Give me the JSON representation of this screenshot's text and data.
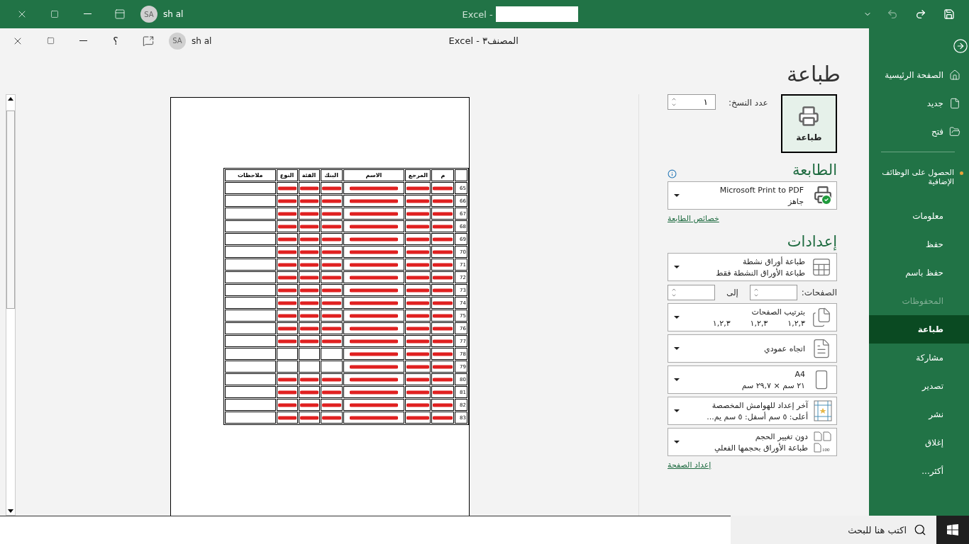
{
  "title_bar": {
    "app": "Excel -",
    "user_initials": "SA",
    "user_name": "sh al"
  },
  "inner_title_bar": {
    "title": "Excel - المصنف٣",
    "help": "؟",
    "user_initials": "SA",
    "user_name": "sh al"
  },
  "sidebar": {
    "top_items": [
      {
        "label": "الصفحة الرئيسية",
        "kind": "home"
      },
      {
        "label": "جديد",
        "kind": "new"
      },
      {
        "label": "فتح",
        "kind": "open"
      }
    ],
    "items": [
      {
        "label": "الحصول على الوظائف الإضافية",
        "notice": true,
        "disabled": false,
        "selected": false
      },
      {
        "label": "معلومات",
        "notice": false,
        "disabled": false,
        "selected": false
      },
      {
        "label": "حفظ",
        "notice": false,
        "disabled": false,
        "selected": false
      },
      {
        "label": "حفظ باسم",
        "notice": false,
        "disabled": false,
        "selected": false
      },
      {
        "label": "المحفوظات",
        "notice": false,
        "disabled": true,
        "selected": false
      },
      {
        "label": "طباعة",
        "notice": false,
        "disabled": false,
        "selected": true
      },
      {
        "label": "مشاركة",
        "notice": false,
        "disabled": false,
        "selected": false
      },
      {
        "label": "تصدير",
        "notice": false,
        "disabled": false,
        "selected": false
      },
      {
        "label": "نشر",
        "notice": false,
        "disabled": false,
        "selected": false
      },
      {
        "label": "إغلاق",
        "notice": false,
        "disabled": false,
        "selected": false
      },
      {
        "label": "أكثر...",
        "notice": false,
        "disabled": false,
        "selected": false
      }
    ]
  },
  "print": {
    "heading": "طباعة",
    "button": "طباعة",
    "copies_label": "عدد النسخ:",
    "copies": "١"
  },
  "printer": {
    "heading": "الطابعة",
    "name": "Microsoft Print to PDF",
    "status": "جاهز",
    "link": "خصائص الطابعة"
  },
  "settings": {
    "heading": "إعدادات",
    "link": "إعداد الصفحة",
    "items": [
      {
        "kind": "sheets",
        "title": "طباعة أوراق نشطة",
        "subtitle": "طباعة الأوراق النشطة فقط"
      },
      {
        "kind": "pages",
        "label": "الصفحات:",
        "to": "إلى"
      },
      {
        "kind": "collate",
        "title": "بترتيب الصفحات",
        "subtitle_parts": [
          "١,٢,٣",
          "١,٢,٣",
          "١,٢,٣"
        ]
      },
      {
        "kind": "orientation",
        "title": "اتجاه عمودي"
      },
      {
        "kind": "paper",
        "title": "A4",
        "subtitle": "٢١ سم × ٢٩,٧ سم"
      },
      {
        "kind": "margins",
        "title": "آخر إعداد للهوامش المخصصة",
        "subtitle": "أعلى: ٥ سم أسفل: ٥ سم يم..."
      },
      {
        "kind": "scaling",
        "title": "دون تغيير الحجم",
        "subtitle": "طباعة الأوراق بحجمها الفعلي",
        "icon_text": "100"
      }
    ]
  },
  "preview": {
    "columns": [
      "م",
      "المرجع",
      "الاسم",
      "البنك",
      "الفئة",
      "النوع",
      "ملاحظات"
    ],
    "rows": [
      {
        "number": "65",
        "kind": "full"
      },
      {
        "number": "66",
        "kind": "full"
      },
      {
        "number": "67",
        "kind": "full"
      },
      {
        "number": "68",
        "kind": "full"
      },
      {
        "number": "69",
        "kind": "full"
      },
      {
        "number": "70",
        "kind": "full"
      },
      {
        "number": "71",
        "kind": "full"
      },
      {
        "number": "72",
        "kind": "full"
      },
      {
        "number": "73",
        "kind": "full"
      },
      {
        "number": "74",
        "kind": "full"
      },
      {
        "number": "75",
        "kind": "full"
      },
      {
        "number": "76",
        "kind": "full"
      },
      {
        "number": "77",
        "kind": "full"
      },
      {
        "number": "78",
        "kind": "partial"
      },
      {
        "number": "79",
        "kind": "partial"
      },
      {
        "number": "80",
        "kind": "full"
      },
      {
        "number": "81",
        "kind": "full"
      },
      {
        "number": "82",
        "kind": "full"
      },
      {
        "number": "83",
        "kind": "full"
      }
    ]
  },
  "taskbar": {
    "search_placeholder": "اكتب هنا للبحث"
  }
}
